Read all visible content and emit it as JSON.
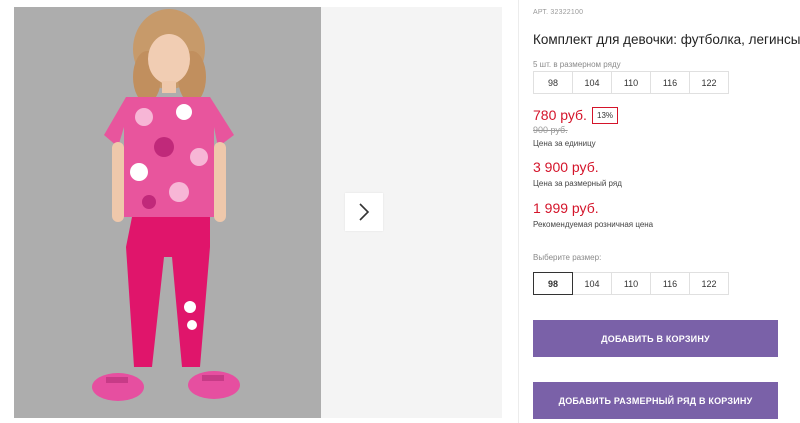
{
  "gallery": {
    "image_alt": "Девочка в футболке и легинсах",
    "next_icon": "chevron-right-icon"
  },
  "product": {
    "sku": "АРТ. 32322100",
    "title": "Комплект для девочки: футболка, легинсы"
  },
  "pack": {
    "note": "5 шт. в размерном ряду",
    "sizes": [
      "98",
      "104",
      "110",
      "116",
      "122"
    ]
  },
  "prices": {
    "current": "780 руб.",
    "discount": "13%",
    "old": "900 руб.",
    "unit_caption": "Цена за единицу",
    "pack_price": "3 900 руб.",
    "pack_caption": "Цена за размерный ряд",
    "rrp_price": "1 999 руб.",
    "rrp_caption": "Рекомендуемая розничная цена"
  },
  "size_select": {
    "label": "Выберите размер:",
    "sizes": [
      "98",
      "104",
      "110",
      "116",
      "122"
    ],
    "selected": "98"
  },
  "buttons": {
    "add_to_cart": "ДОБАВИТЬ В КОРЗИНУ",
    "add_pack_to_cart": "ДОБАВИТЬ РАЗМЕРНЫЙ РЯД В КОРЗИНУ"
  },
  "colors": {
    "accent": "#7a61a8",
    "price": "#d4142a"
  }
}
